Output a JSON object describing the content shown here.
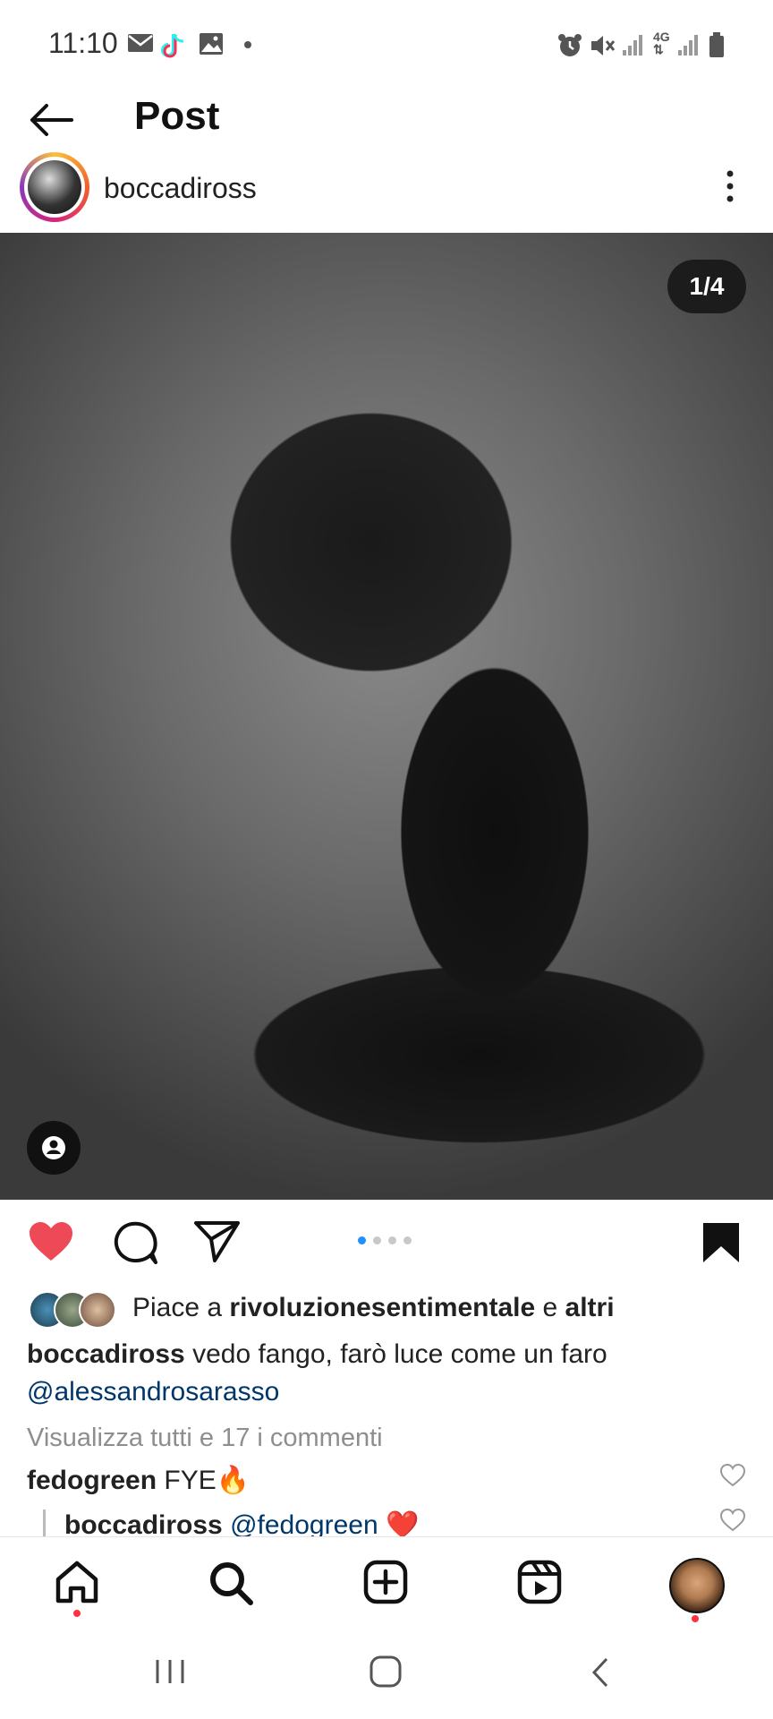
{
  "status_bar": {
    "time": "11:10",
    "left_icons": [
      "mail-icon",
      "tiktok-icon",
      "gallery-icon",
      "dot-icon"
    ],
    "right_icons": [
      "alarm-icon",
      "mute-icon",
      "signal-icon",
      "4g-icon",
      "signal-icon",
      "battery-icon"
    ]
  },
  "header": {
    "title": "Post"
  },
  "post": {
    "username": "boccadiross",
    "image_counter": "1/4",
    "carousel": {
      "total": 4,
      "active_index": 0
    },
    "likes": {
      "prefix": "Piace a ",
      "user": "rivoluzionesentimentale",
      "connector": " e ",
      "others": "altri"
    },
    "caption": {
      "username": "boccadiross",
      "text": " vedo fango, farò luce come un faro",
      "mention": "@alessandrosarasso"
    },
    "view_all_comments": "Visualizza tutti e 17 i commenti",
    "comments": [
      {
        "username": "fedogreen",
        "text": " FYE🔥"
      },
      {
        "username": "boccadiross",
        "mention": " @fedogreen",
        "text": " ❤️"
      }
    ]
  },
  "colors": {
    "like_red": "#ed4956",
    "mention_blue": "#00376b",
    "active_dot": "#1e90ff",
    "notif_red": "#ff3040"
  },
  "bottom_nav": [
    "home-icon",
    "search-icon",
    "create-icon",
    "reels-icon",
    "profile-avatar"
  ],
  "system_nav": [
    "recents-icon",
    "home-button-icon",
    "back-icon"
  ]
}
